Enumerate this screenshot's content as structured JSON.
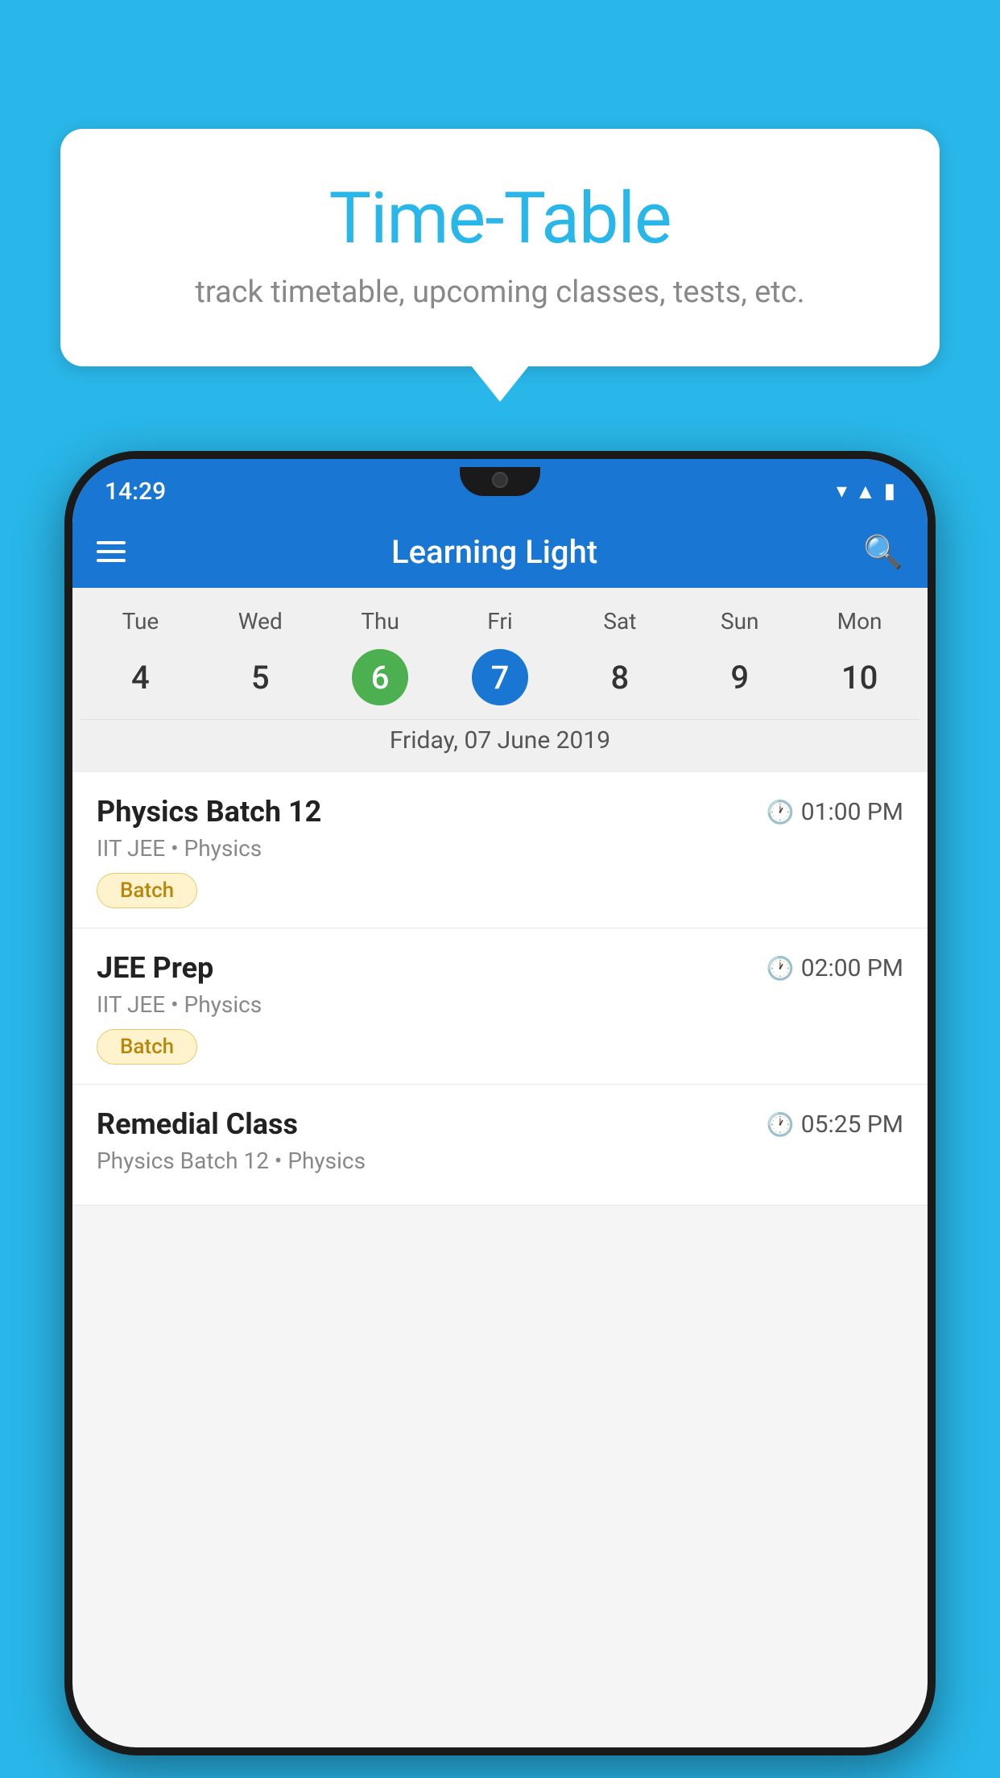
{
  "background_color": "#29b6e8",
  "card": {
    "title": "Time-Table",
    "subtitle": "track timetable, upcoming classes, tests, etc."
  },
  "phone": {
    "status_bar": {
      "time": "14:29"
    },
    "app_header": {
      "title": "Learning Light"
    },
    "calendar": {
      "days": [
        "Tue",
        "Wed",
        "Thu",
        "Fri",
        "Sat",
        "Sun",
        "Mon"
      ],
      "dates": [
        "4",
        "5",
        "6",
        "7",
        "8",
        "9",
        "10"
      ],
      "today_index": 2,
      "selected_index": 3,
      "selected_label": "Friday, 07 June 2019"
    },
    "schedule": [
      {
        "title": "Physics Batch 12",
        "time": "01:00 PM",
        "meta": "IIT JEE • Physics",
        "tag": "Batch"
      },
      {
        "title": "JEE Prep",
        "time": "02:00 PM",
        "meta": "IIT JEE • Physics",
        "tag": "Batch"
      },
      {
        "title": "Remedial Class",
        "time": "05:25 PM",
        "meta": "Physics Batch 12 • Physics",
        "tag": ""
      }
    ]
  }
}
